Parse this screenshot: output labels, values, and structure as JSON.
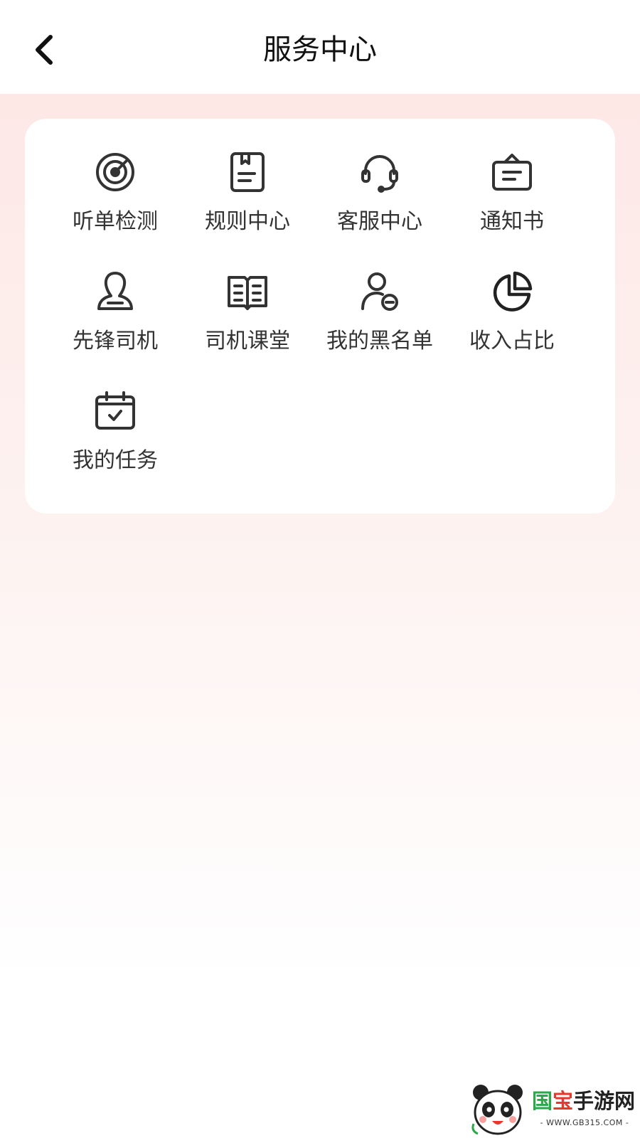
{
  "header": {
    "title": "服务中心",
    "back_icon": "chevron-left-icon"
  },
  "services": [
    {
      "label": "听单检测",
      "icon": "radar-icon"
    },
    {
      "label": "规则中心",
      "icon": "rulebook-icon"
    },
    {
      "label": "客服中心",
      "icon": "headset-icon"
    },
    {
      "label": "通知书",
      "icon": "notice-board-icon"
    },
    {
      "label": "先锋司机",
      "icon": "user-icon"
    },
    {
      "label": "司机课堂",
      "icon": "open-book-icon"
    },
    {
      "label": "我的黑名单",
      "icon": "user-blocked-icon"
    },
    {
      "label": "收入占比",
      "icon": "pie-chart-icon"
    },
    {
      "label": "我的任务",
      "icon": "calendar-check-icon"
    }
  ],
  "watermark": {
    "brand_part1": "国",
    "brand_part2": "宝",
    "brand_part3": "手游网",
    "url": "- WWW.GB315.COM -"
  },
  "colors": {
    "background_top": "#fde8e6",
    "card": "#ffffff",
    "icon_stroke": "#333333",
    "text": "#333333"
  }
}
